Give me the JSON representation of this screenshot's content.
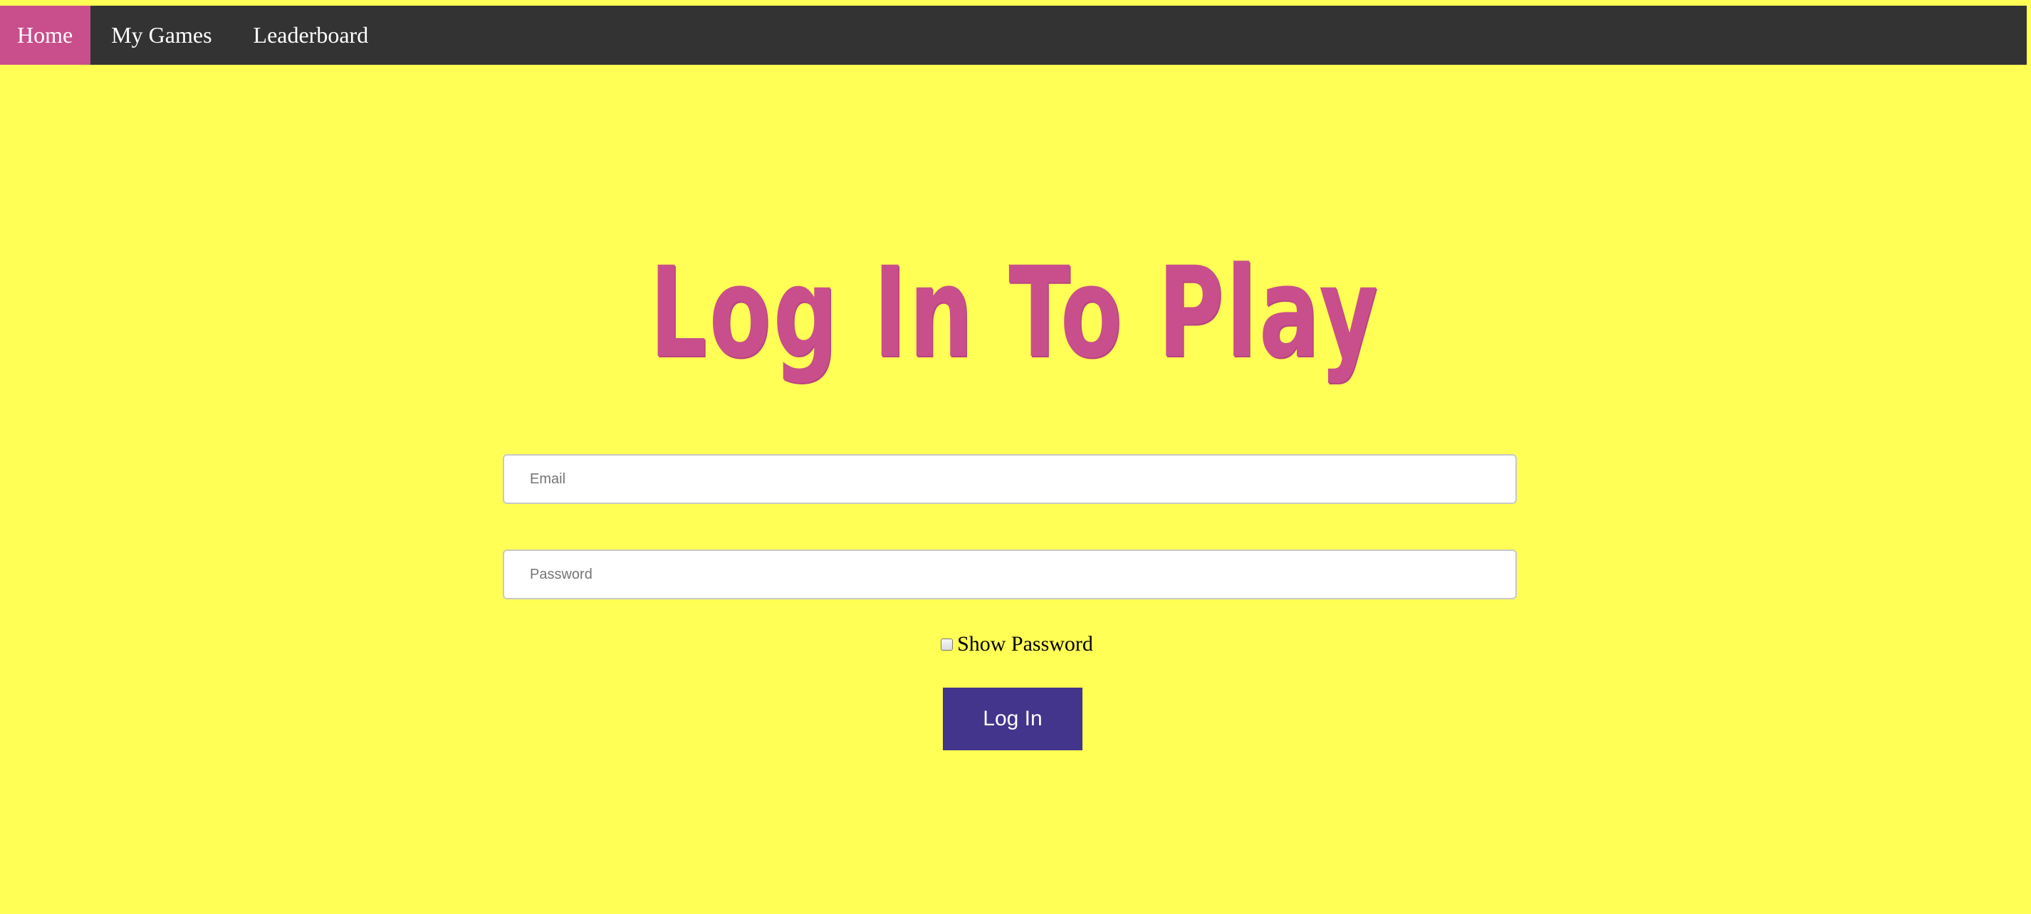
{
  "nav": {
    "items": [
      {
        "label": "Home",
        "active": true
      },
      {
        "label": "My Games",
        "active": false
      },
      {
        "label": "Leaderboard",
        "active": false
      }
    ]
  },
  "main": {
    "title": "Log In To Play",
    "email": {
      "placeholder": "Email",
      "value": ""
    },
    "password": {
      "placeholder": "Password",
      "value": ""
    },
    "show_password": {
      "label": "Show Password",
      "checked": false
    },
    "login_button": "Log In"
  },
  "colors": {
    "background": "#ffff55",
    "navbar": "#333333",
    "accent": "#c84f8c",
    "button": "#43348c"
  }
}
